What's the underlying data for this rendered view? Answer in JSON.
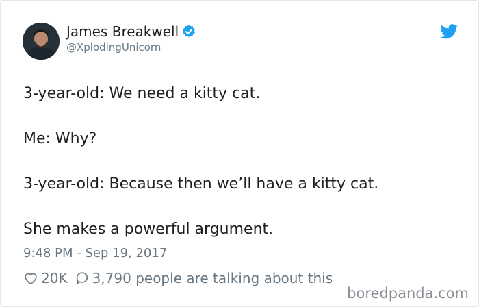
{
  "author": {
    "display_name": "James Breakwell",
    "handle": "@XplodingUnicorn",
    "verified": true
  },
  "tweet": {
    "lines": [
      "3-year-old: We need a kitty cat.",
      "Me: Why?",
      "3-year-old: Because then we’ll have a kitty cat.",
      "She makes a powerful argument."
    ],
    "timestamp": "9:48 PM - Sep 19, 2017"
  },
  "engagement": {
    "likes": "20K",
    "replies_text": "3,790 people are talking about this"
  },
  "watermark": "boredpanda.com",
  "colors": {
    "twitter_blue": "#1da1f2",
    "text_primary": "#1c2022",
    "text_secondary": "#697882"
  },
  "icons": {
    "platform": "twitter-bird-icon",
    "verified": "verified-badge-icon",
    "like": "heart-icon",
    "reply": "speech-bubble-icon"
  }
}
